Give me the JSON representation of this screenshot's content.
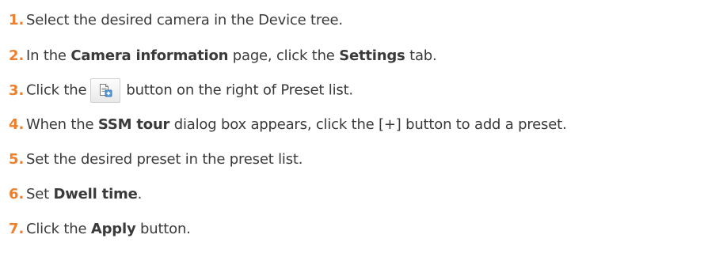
{
  "steps": [
    {
      "number": "1.",
      "text": "Select the desired camera in the Device tree."
    },
    {
      "number": "2.",
      "pre": "In the ",
      "bold1": "Camera information",
      "mid": " page, click the ",
      "bold2": "Settings",
      "post": " tab."
    },
    {
      "number": "3.",
      "pre": "Click the",
      "post": "button on the right of Preset list.",
      "button_icon": "add-preset-document-icon"
    },
    {
      "number": "4.",
      "pre": "When the ",
      "bold1": "SSM tour",
      "post": " dialog box appears, click the [+] button to add a preset."
    },
    {
      "number": "5.",
      "text": "Set the desired preset in the preset list."
    },
    {
      "number": "6.",
      "pre": "Set ",
      "bold1": "Dwell time",
      "post": "."
    },
    {
      "number": "7.",
      "pre": "Click the ",
      "bold1": "Apply",
      "post": " button."
    }
  ],
  "colors": {
    "step_number": "#f07f2c",
    "body_text": "#3a3a3a",
    "icon_accent": "#5b9bd5"
  }
}
